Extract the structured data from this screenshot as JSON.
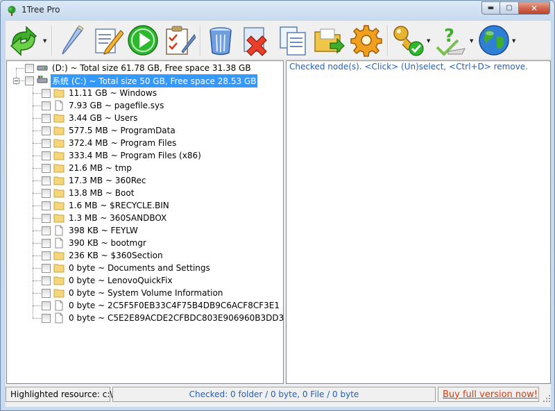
{
  "window": {
    "title": "1Tree Pro",
    "buttons": {
      "minimize": "▬",
      "maximize": "▢",
      "close": "✕"
    }
  },
  "toolbar": {
    "buttons": [
      {
        "icon": "refresh-arrows-icon"
      },
      {
        "icon": "pencil-icon"
      },
      {
        "icon": "edit-document-icon"
      },
      {
        "icon": "play-icon"
      },
      {
        "icon": "checklist-icon"
      },
      {
        "icon": "trash-can-icon"
      },
      {
        "icon": "delete-x-icon"
      },
      {
        "icon": "copy-documents-icon"
      },
      {
        "icon": "move-folder-icon"
      },
      {
        "icon": "gear-icon"
      },
      {
        "icon": "key-check-icon"
      },
      {
        "icon": "help-check-icon"
      },
      {
        "icon": "globe-icon"
      }
    ],
    "dropdown_arrow": "▼"
  },
  "tree": {
    "drives": [
      {
        "label": "(D:) ~ Total size 61.78 GB, Free space 31.38 GB",
        "icon": "drive-icon"
      },
      {
        "label": "系统 (C:) ~ Total size 50 GB, Free space 28.53 GB",
        "icon": "system-drive-icon",
        "selected": true
      }
    ],
    "items": [
      {
        "label": "11.11 GB ~ Windows",
        "type": "folder"
      },
      {
        "label": "7.93 GB ~ pagefile.sys",
        "type": "file"
      },
      {
        "label": "3.44 GB ~ Users",
        "type": "folder"
      },
      {
        "label": "577.5 MB ~ ProgramData",
        "type": "folder"
      },
      {
        "label": "372.4 MB ~ Program Files",
        "type": "folder"
      },
      {
        "label": "333.4 MB ~ Program Files (x86)",
        "type": "folder"
      },
      {
        "label": "21.6 MB ~ tmp",
        "type": "folder"
      },
      {
        "label": "17.3 MB ~ 360Rec",
        "type": "folder"
      },
      {
        "label": "13.8 MB ~ Boot",
        "type": "folder"
      },
      {
        "label": "1.6 MB ~ $RECYCLE.BIN",
        "type": "folder"
      },
      {
        "label": "1.3 MB ~ 360SANDBOX",
        "type": "folder"
      },
      {
        "label": "398 KB ~ FEYLW",
        "type": "file"
      },
      {
        "label": "390 KB ~ bootmgr",
        "type": "file"
      },
      {
        "label": "236 KB ~ $360Section",
        "type": "folder"
      },
      {
        "label": "0 byte ~ Documents and Settings",
        "type": "folder"
      },
      {
        "label": "0 byte ~ LenovoQuickFix",
        "type": "folder"
      },
      {
        "label": "0 byte ~ System Volume Information",
        "type": "folder"
      },
      {
        "label": "0 byte ~ 2C5F5F0EB33C4F75B4DB9C6ACF8CF3E1",
        "type": "file"
      },
      {
        "label": "0 byte ~ C5E2E89ACDE2CFBDC803E906960B3DD3",
        "type": "file"
      }
    ]
  },
  "right_pane": {
    "hint": "Checked node(s). <Click> (Un)select, <Ctrl+D> remove."
  },
  "status": {
    "highlighted": "Highlighted resource: c:\\",
    "checked": "Checked:  0 folder / 0  byte, 0 File / 0  byte",
    "buy": "Buy full version now!"
  },
  "colors": {
    "selection": "#3399ff",
    "hint_text": "#1f5fbf",
    "buy_link": "#d23b10",
    "folder": "#f5d67a"
  }
}
